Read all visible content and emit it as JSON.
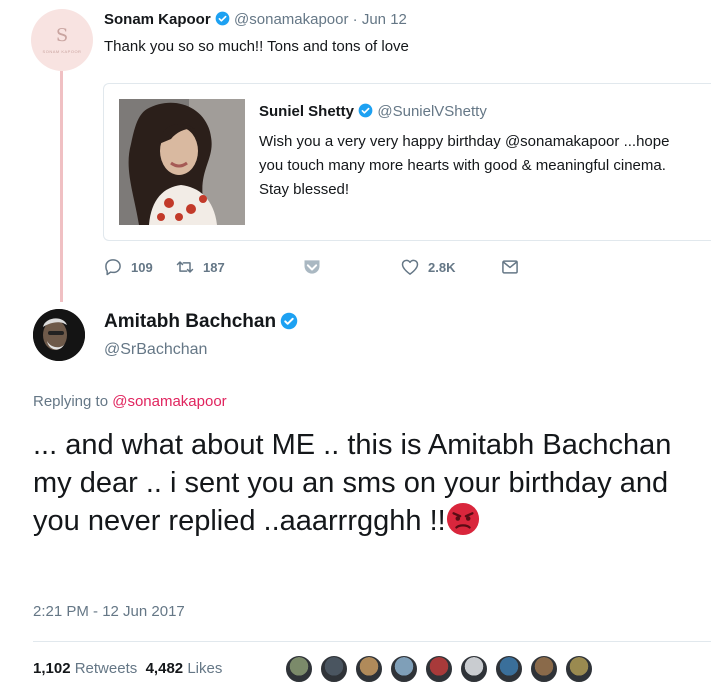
{
  "tweet1": {
    "avatar_mono": "S",
    "avatar_sub": "SONAM KAPOOR",
    "name": "Sonam Kapoor",
    "handle": "@sonamakapoor",
    "date": "Jun 12",
    "text": "Thank you so so much!! Tons and tons of love"
  },
  "quoted": {
    "name": "Suniel Shetty",
    "handle": "@SunielVShetty",
    "text": "Wish you a very very happy birthday @sonamakapoor ...hope you touch many more hearts with good & meaningful cinema. Stay blessed!"
  },
  "actions": {
    "replies": "109",
    "retweets": "187",
    "likes": "2.8K"
  },
  "tweet2": {
    "name": "Amitabh Bachchan",
    "handle": "@SrBachchan",
    "replying_label": "Replying to",
    "replying_to": "@sonamakapoor",
    "text": "... and what about ME .. this is Amitabh Bachchan my dear .. i sent you an sms on your birthday and you never replied ..aaarrrgghh !!",
    "timestamp": "2:21 PM - 12 Jun 2017",
    "retweet_count": "1,102",
    "retweet_label": "Retweets",
    "like_count": "4,482",
    "like_label": "Likes"
  },
  "colors": {
    "verified": "#1da1f2",
    "thread_line": "#f0c0c3",
    "mention": "#e0245e",
    "muted": "#657786",
    "angry_emoji": "#d9263c"
  },
  "icons": [
    "reply-icon",
    "retweet-icon",
    "caret-down-icon",
    "heart-icon",
    "direct-message-icon",
    "verified-badge-icon",
    "angry-face-emoji"
  ],
  "liker_colors": [
    "#7b8a6a",
    "#4a5560",
    "#b08a5a",
    "#7f9fb8",
    "#a83a3a",
    "#c9ccd0",
    "#3a6f9a",
    "#8a6a4a",
    "#9a8a50"
  ]
}
